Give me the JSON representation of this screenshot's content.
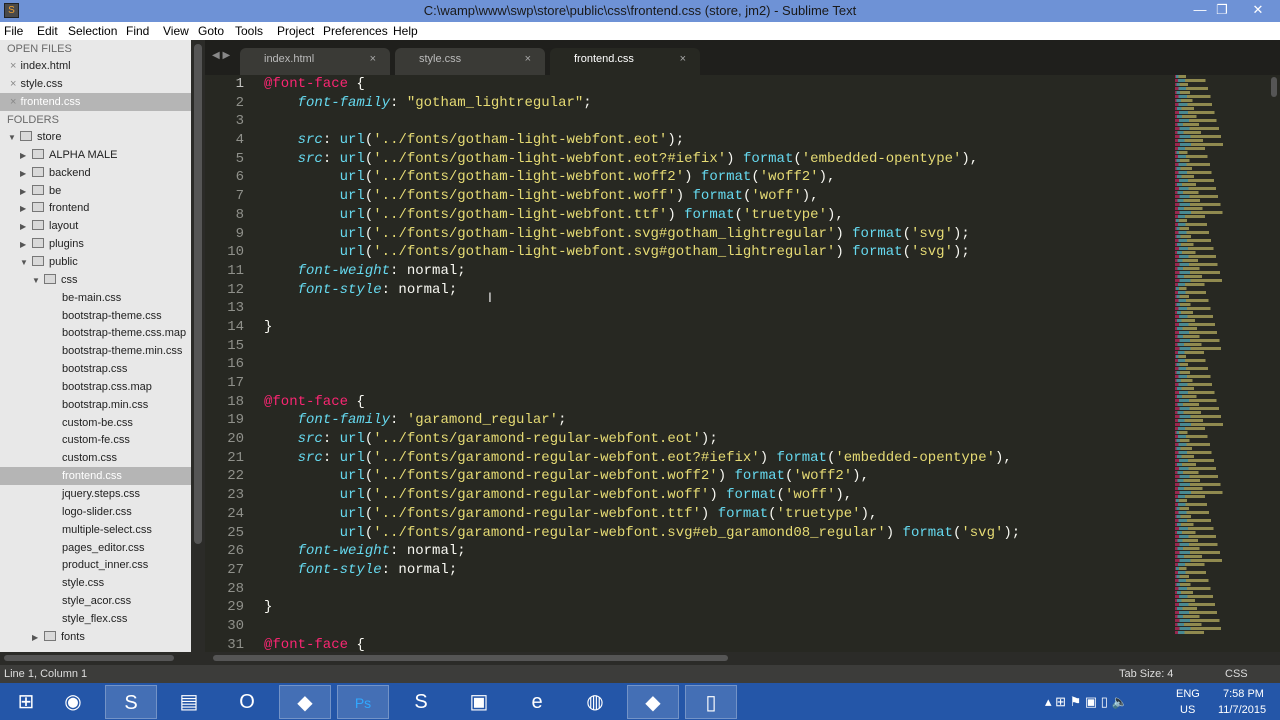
{
  "window": {
    "title": "C:\\wamp\\www\\swp\\store\\public\\css\\frontend.css (store, jm2) - Sublime Text",
    "app_icon": "S",
    "minimize": "—",
    "maximize": "❐",
    "close": "✕"
  },
  "menu": [
    "File",
    "Edit",
    "Selection",
    "Find",
    "View",
    "Goto",
    "Tools",
    "Project",
    "Preferences",
    "Help"
  ],
  "sidebar": {
    "open_files_label": "OPEN FILES",
    "open_files": [
      "index.html",
      "style.css",
      "frontend.css"
    ],
    "folders_label": "FOLDERS",
    "tree": [
      {
        "label": "store",
        "depth": 0,
        "open": true
      },
      {
        "label": "ALPHA MALE",
        "depth": 1,
        "open": false
      },
      {
        "label": "backend",
        "depth": 1,
        "open": false
      },
      {
        "label": "be",
        "depth": 1,
        "open": false
      },
      {
        "label": "frontend",
        "depth": 1,
        "open": false
      },
      {
        "label": "layout",
        "depth": 1,
        "open": false
      },
      {
        "label": "plugins",
        "depth": 1,
        "open": false
      },
      {
        "label": "public",
        "depth": 1,
        "open": true
      },
      {
        "label": "css",
        "depth": 2,
        "open": true
      },
      {
        "label": "be-main.css",
        "depth": 3,
        "file": true
      },
      {
        "label": "bootstrap-theme.css",
        "depth": 3,
        "file": true
      },
      {
        "label": "bootstrap-theme.css.map",
        "depth": 3,
        "file": true
      },
      {
        "label": "bootstrap-theme.min.css",
        "depth": 3,
        "file": true
      },
      {
        "label": "bootstrap.css",
        "depth": 3,
        "file": true
      },
      {
        "label": "bootstrap.css.map",
        "depth": 3,
        "file": true
      },
      {
        "label": "bootstrap.min.css",
        "depth": 3,
        "file": true
      },
      {
        "label": "custom-be.css",
        "depth": 3,
        "file": true
      },
      {
        "label": "custom-fe.css",
        "depth": 3,
        "file": true
      },
      {
        "label": "custom.css",
        "depth": 3,
        "file": true
      },
      {
        "label": "frontend.css",
        "depth": 3,
        "file": true,
        "selected": true
      },
      {
        "label": "jquery.steps.css",
        "depth": 3,
        "file": true
      },
      {
        "label": "logo-slider.css",
        "depth": 3,
        "file": true
      },
      {
        "label": "multiple-select.css",
        "depth": 3,
        "file": true
      },
      {
        "label": "pages_editor.css",
        "depth": 3,
        "file": true
      },
      {
        "label": "product_inner.css",
        "depth": 3,
        "file": true
      },
      {
        "label": "style.css",
        "depth": 3,
        "file": true
      },
      {
        "label": "style_acor.css",
        "depth": 3,
        "file": true
      },
      {
        "label": "style_flex.css",
        "depth": 3,
        "file": true
      },
      {
        "label": "fonts",
        "depth": 2,
        "open": false
      }
    ]
  },
  "tabs": [
    {
      "label": "index.html",
      "close": "×"
    },
    {
      "label": "style.css",
      "close": "×"
    },
    {
      "label": "frontend.css",
      "close": "×",
      "active": true
    }
  ],
  "editor": {
    "first_line": 1,
    "lines": [
      [
        [
          "at",
          "@font-face"
        ],
        [
          "p",
          " {"
        ]
      ],
      [
        [
          "p",
          "    "
        ],
        [
          "prop",
          "font-family"
        ],
        [
          "p",
          ": "
        ],
        [
          "str",
          "\"gotham_lightregular\""
        ],
        [
          "p",
          ";"
        ]
      ],
      [],
      [
        [
          "p",
          "    "
        ],
        [
          "prop",
          "src"
        ],
        [
          "p",
          ": "
        ],
        [
          "fn",
          "url"
        ],
        [
          "p",
          "("
        ],
        [
          "str",
          "'../fonts/gotham-light-webfont.eot'"
        ],
        [
          "p",
          ");"
        ]
      ],
      [
        [
          "p",
          "    "
        ],
        [
          "prop",
          "src"
        ],
        [
          "p",
          ": "
        ],
        [
          "fn",
          "url"
        ],
        [
          "p",
          "("
        ],
        [
          "str",
          "'../fonts/gotham-light-webfont.eot?#iefix'"
        ],
        [
          "p",
          ") "
        ],
        [
          "fn",
          "format"
        ],
        [
          "p",
          "("
        ],
        [
          "str",
          "'embedded-opentype'"
        ],
        [
          "p",
          "),"
        ]
      ],
      [
        [
          "p",
          "         "
        ],
        [
          "fn",
          "url"
        ],
        [
          "p",
          "("
        ],
        [
          "str",
          "'../fonts/gotham-light-webfont.woff2'"
        ],
        [
          "p",
          ") "
        ],
        [
          "fn",
          "format"
        ],
        [
          "p",
          "("
        ],
        [
          "str",
          "'woff2'"
        ],
        [
          "p",
          "),"
        ]
      ],
      [
        [
          "p",
          "         "
        ],
        [
          "fn",
          "url"
        ],
        [
          "p",
          "("
        ],
        [
          "str",
          "'../fonts/gotham-light-webfont.woff'"
        ],
        [
          "p",
          ") "
        ],
        [
          "fn",
          "format"
        ],
        [
          "p",
          "("
        ],
        [
          "str",
          "'woff'"
        ],
        [
          "p",
          "),"
        ]
      ],
      [
        [
          "p",
          "         "
        ],
        [
          "fn",
          "url"
        ],
        [
          "p",
          "("
        ],
        [
          "str",
          "'../fonts/gotham-light-webfont.ttf'"
        ],
        [
          "p",
          ") "
        ],
        [
          "fn",
          "format"
        ],
        [
          "p",
          "("
        ],
        [
          "str",
          "'truetype'"
        ],
        [
          "p",
          "),"
        ]
      ],
      [
        [
          "p",
          "         "
        ],
        [
          "fn",
          "url"
        ],
        [
          "p",
          "("
        ],
        [
          "str",
          "'../fonts/gotham-light-webfont.svg#gotham_lightregular'"
        ],
        [
          "p",
          ") "
        ],
        [
          "fn",
          "format"
        ],
        [
          "p",
          "("
        ],
        [
          "str",
          "'svg'"
        ],
        [
          "p",
          ");"
        ]
      ],
      [
        [
          "p",
          "         "
        ],
        [
          "fn",
          "url"
        ],
        [
          "p",
          "("
        ],
        [
          "str",
          "'../fonts/gotham-light-webfont.svg#gotham_lightregular'"
        ],
        [
          "p",
          ") "
        ],
        [
          "fn",
          "format"
        ],
        [
          "p",
          "("
        ],
        [
          "str",
          "'svg'"
        ],
        [
          "p",
          ");"
        ]
      ],
      [
        [
          "p",
          "    "
        ],
        [
          "prop",
          "font-weight"
        ],
        [
          "p",
          ": normal;"
        ]
      ],
      [
        [
          "p",
          "    "
        ],
        [
          "prop",
          "font-style"
        ],
        [
          "p",
          ": normal;"
        ]
      ],
      [],
      [
        [
          "p",
          "}"
        ]
      ],
      [],
      [],
      [],
      [
        [
          "at",
          "@font-face"
        ],
        [
          "p",
          " {"
        ]
      ],
      [
        [
          "p",
          "    "
        ],
        [
          "prop",
          "font-family"
        ],
        [
          "p",
          ": "
        ],
        [
          "str",
          "'garamond_regular'"
        ],
        [
          "p",
          ";"
        ]
      ],
      [
        [
          "p",
          "    "
        ],
        [
          "prop",
          "src"
        ],
        [
          "p",
          ": "
        ],
        [
          "fn",
          "url"
        ],
        [
          "p",
          "("
        ],
        [
          "str",
          "'../fonts/garamond-regular-webfont.eot'"
        ],
        [
          "p",
          ");"
        ]
      ],
      [
        [
          "p",
          "    "
        ],
        [
          "prop",
          "src"
        ],
        [
          "p",
          ": "
        ],
        [
          "fn",
          "url"
        ],
        [
          "p",
          "("
        ],
        [
          "str",
          "'../fonts/garamond-regular-webfont.eot?#iefix'"
        ],
        [
          "p",
          ") "
        ],
        [
          "fn",
          "format"
        ],
        [
          "p",
          "("
        ],
        [
          "str",
          "'embedded-opentype'"
        ],
        [
          "p",
          "),"
        ]
      ],
      [
        [
          "p",
          "         "
        ],
        [
          "fn",
          "url"
        ],
        [
          "p",
          "("
        ],
        [
          "str",
          "'../fonts/garamond-regular-webfont.woff2'"
        ],
        [
          "p",
          ") "
        ],
        [
          "fn",
          "format"
        ],
        [
          "p",
          "("
        ],
        [
          "str",
          "'woff2'"
        ],
        [
          "p",
          "),"
        ]
      ],
      [
        [
          "p",
          "         "
        ],
        [
          "fn",
          "url"
        ],
        [
          "p",
          "("
        ],
        [
          "str",
          "'../fonts/garamond-regular-webfont.woff'"
        ],
        [
          "p",
          ") "
        ],
        [
          "fn",
          "format"
        ],
        [
          "p",
          "("
        ],
        [
          "str",
          "'woff'"
        ],
        [
          "p",
          "),"
        ]
      ],
      [
        [
          "p",
          "         "
        ],
        [
          "fn",
          "url"
        ],
        [
          "p",
          "("
        ],
        [
          "str",
          "'../fonts/garamond-regular-webfont.ttf'"
        ],
        [
          "p",
          ") "
        ],
        [
          "fn",
          "format"
        ],
        [
          "p",
          "("
        ],
        [
          "str",
          "'truetype'"
        ],
        [
          "p",
          "),"
        ]
      ],
      [
        [
          "p",
          "         "
        ],
        [
          "fn",
          "url"
        ],
        [
          "p",
          "("
        ],
        [
          "str",
          "'../fonts/garamond-regular-webfont.svg#eb_garamond08_regular'"
        ],
        [
          "p",
          ") "
        ],
        [
          "fn",
          "format"
        ],
        [
          "p",
          "("
        ],
        [
          "str",
          "'svg'"
        ],
        [
          "p",
          ");"
        ]
      ],
      [
        [
          "p",
          "    "
        ],
        [
          "prop",
          "font-weight"
        ],
        [
          "p",
          ": normal;"
        ]
      ],
      [
        [
          "p",
          "    "
        ],
        [
          "prop",
          "font-style"
        ],
        [
          "p",
          ": normal;"
        ]
      ],
      [],
      [
        [
          "p",
          "}"
        ]
      ],
      [],
      [
        [
          "at",
          "@font-face"
        ],
        [
          "p",
          " {"
        ]
      ]
    ]
  },
  "status": {
    "position": "Line 1, Column 1",
    "tab_size": "Tab Size: 4",
    "syntax": "CSS"
  },
  "taskbar": {
    "apps": [
      {
        "name": "start",
        "glyph": "⊞"
      },
      {
        "name": "chrome",
        "glyph": "◉"
      },
      {
        "name": "sublime-text",
        "glyph": "S",
        "open": true
      },
      {
        "name": "file-explorer",
        "glyph": "▤"
      },
      {
        "name": "opera",
        "glyph": "O"
      },
      {
        "name": "app-a",
        "glyph": "◆",
        "open": true
      },
      {
        "name": "photoshop",
        "glyph": "Ps",
        "open": true
      },
      {
        "name": "skype",
        "glyph": "S"
      },
      {
        "name": "monitor",
        "glyph": "▣"
      },
      {
        "name": "internet-explorer",
        "glyph": "e"
      },
      {
        "name": "firefox",
        "glyph": "◍"
      },
      {
        "name": "app-b",
        "glyph": "◆",
        "open": true
      },
      {
        "name": "notepad",
        "glyph": "▯",
        "open": true
      }
    ],
    "lang": "ENG",
    "region": "US",
    "time": "7:58 PM",
    "date": "11/7/2015"
  },
  "colors": {
    "keyword": "#f92672",
    "property": "#66d9ef",
    "string": "#e6db74",
    "text": "#f8f8f2",
    "background": "#272822"
  }
}
